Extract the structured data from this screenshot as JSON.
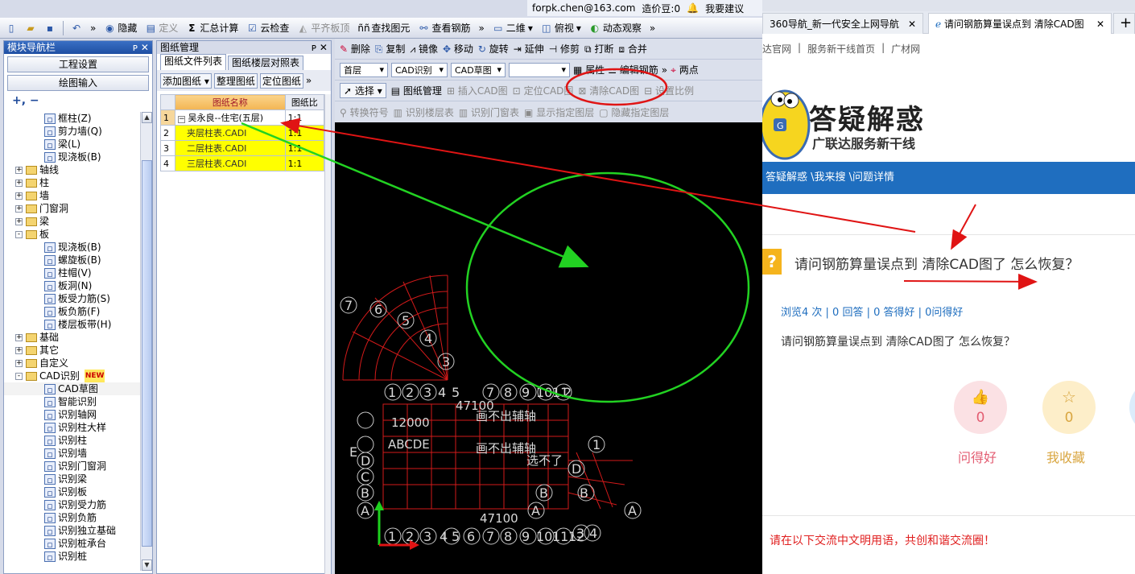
{
  "topbar": {
    "email": "forpk.chen@163.com",
    "price_label": "造价豆:0",
    "suggest": "我要建议"
  },
  "toolbar": {
    "hide": "隐藏",
    "define": "定义",
    "sum_calc": "汇总计算",
    "cloud_check": "云检查",
    "flat_top": "平齐板顶",
    "find_element": "查找图元",
    "view_rebar": "查看钢筋",
    "view_2d": "二维",
    "view_mode": "俯视",
    "dynamic_view": "动态观察"
  },
  "nav_panel": {
    "title": "模块导航栏",
    "project_settings": "工程设置",
    "drawing_input": "绘图输入",
    "tree": [
      {
        "label": "框柱(Z)",
        "level": 2,
        "icon": "column-icon"
      },
      {
        "label": "剪力墙(Q)",
        "level": 2,
        "icon": "wall-icon"
      },
      {
        "label": "梁(L)",
        "level": 2,
        "icon": "beam-icon"
      },
      {
        "label": "现浇板(B)",
        "level": 2,
        "icon": "slab-icon"
      },
      {
        "label": "轴线",
        "level": 1,
        "folder": true,
        "exp": "+"
      },
      {
        "label": "柱",
        "level": 1,
        "folder": true,
        "exp": "+"
      },
      {
        "label": "墙",
        "level": 1,
        "folder": true,
        "exp": "+"
      },
      {
        "label": "门窗洞",
        "level": 1,
        "folder": true,
        "exp": "+"
      },
      {
        "label": "梁",
        "level": 1,
        "folder": true,
        "exp": "+"
      },
      {
        "label": "板",
        "level": 1,
        "folder": true,
        "exp": "-"
      },
      {
        "label": "现浇板(B)",
        "level": 2,
        "icon": "slab-icon"
      },
      {
        "label": "螺旋板(B)",
        "level": 2,
        "icon": "spiral-slab-icon"
      },
      {
        "label": "柱帽(V)",
        "level": 2,
        "icon": "column-cap-icon"
      },
      {
        "label": "板洞(N)",
        "level": 2,
        "icon": "slab-hole-icon"
      },
      {
        "label": "板受力筋(S)",
        "level": 2,
        "icon": "slab-rebar-icon"
      },
      {
        "label": "板负筋(F)",
        "level": 2,
        "icon": "negative-rebar-icon"
      },
      {
        "label": "楼层板带(H)",
        "level": 2,
        "icon": "floor-strip-icon"
      },
      {
        "label": "基础",
        "level": 1,
        "folder": true,
        "exp": "+"
      },
      {
        "label": "其它",
        "level": 1,
        "folder": true,
        "exp": "+"
      },
      {
        "label": "自定义",
        "level": 1,
        "folder": true,
        "exp": "+"
      },
      {
        "label": "CAD识别",
        "level": 1,
        "folder": true,
        "exp": "-",
        "badge": "NEW"
      },
      {
        "label": "CAD草图",
        "level": 2,
        "icon": "cad-sketch-icon",
        "selected": true
      },
      {
        "label": "智能识别",
        "level": 2,
        "icon": "smart-recognize-icon"
      },
      {
        "label": "识别轴网",
        "level": 2,
        "icon": "grid-icon"
      },
      {
        "label": "识别柱大样",
        "level": 2,
        "icon": "column-detail-icon"
      },
      {
        "label": "识别柱",
        "level": 2,
        "icon": "column-icon"
      },
      {
        "label": "识别墙",
        "level": 2,
        "icon": "wall-icon"
      },
      {
        "label": "识别门窗洞",
        "level": 2,
        "icon": "door-window-icon"
      },
      {
        "label": "识别梁",
        "level": 2,
        "icon": "beam-icon"
      },
      {
        "label": "识别板",
        "level": 2,
        "icon": "slab-icon"
      },
      {
        "label": "识别受力筋",
        "level": 2,
        "icon": "rebar-icon"
      },
      {
        "label": "识别负筋",
        "level": 2,
        "icon": "negative-rebar-icon"
      },
      {
        "label": "识别独立基础",
        "level": 2,
        "icon": "foundation-icon"
      },
      {
        "label": "识别桩承台",
        "level": 2,
        "icon": "pile-cap-icon"
      },
      {
        "label": "识别桩",
        "level": 2,
        "icon": "pile-icon"
      }
    ]
  },
  "drawing_panel": {
    "title": "图纸管理",
    "tabs": [
      "图纸文件列表",
      "图纸楼层对照表"
    ],
    "buttons": [
      "添加图纸",
      "整理图纸",
      "定位图纸"
    ],
    "col_name": "图纸名称",
    "col_scale": "图纸比",
    "rows": [
      {
        "no": "1",
        "name": "吴永良--住宅(五层)",
        "scale": "1:1",
        "parent": true
      },
      {
        "no": "2",
        "name": "夹层柱表.CADI",
        "scale": "1:1"
      },
      {
        "no": "3",
        "name": "二层柱表.CADI",
        "scale": "1:1"
      },
      {
        "no": "4",
        "name": "三层柱表.CADI",
        "scale": "1:1"
      }
    ]
  },
  "right_toolbar": {
    "row1": [
      "删除",
      "复制",
      "镜像",
      "移动",
      "旋转",
      "延伸",
      "修剪",
      "打断",
      "合并"
    ],
    "floor": "首层",
    "cad_recognize": "CAD识别",
    "cad_sketch": "CAD草图",
    "properties": "属性",
    "edit_rebar": "编辑钢筋",
    "two_points": "两点",
    "select": "选择",
    "drawing_mgmt": "图纸管理",
    "insert_cad": "插入CAD图",
    "locate_cad": "定位CAD图",
    "clear_cad": "清除CAD图",
    "set_scale": "设置比例",
    "row4": [
      "转换符号",
      "识别楼层表",
      "识别门窗表",
      "显示指定图层",
      "隐藏指定图层"
    ]
  },
  "canvas": {
    "texts": [
      "画不出辅轴",
      "选不了",
      "47100",
      "12000",
      "ABCDE"
    ]
  },
  "browser": {
    "tab1": "360导航_新一代安全上网导航",
    "tab2": "请问钢筋算量误点到 清除CAD图",
    "nav": [
      "达官网",
      "服务新干线首页",
      "广材网"
    ],
    "banner_title": "答疑解惑",
    "banner_sub": "广联达服务新干线",
    "breadcrumb": "答疑解惑 \\我来搜 \\问题详情",
    "question_title": "请问钢筋算量误点到 清除CAD图了 怎么恢复？",
    "stats": "浏览4 次 | 0 回答 | 0 答得好 | 0问得好",
    "question_body": "请问钢筋算量误点到 清除CAD图了  怎么恢复？",
    "good_count": "0",
    "good_label": "问得好",
    "fav_count": "0",
    "fav_label": "我收藏",
    "footer": "请在以下交流中文明用语，共创和谐交流圈！"
  },
  "colors": {
    "accent_blue": "#1f6ebf",
    "red_annotation": "#e01414",
    "green_annotation": "#22d222",
    "pink_btn": "#fbe1e4",
    "yellow_btn": "#fdeec9"
  }
}
